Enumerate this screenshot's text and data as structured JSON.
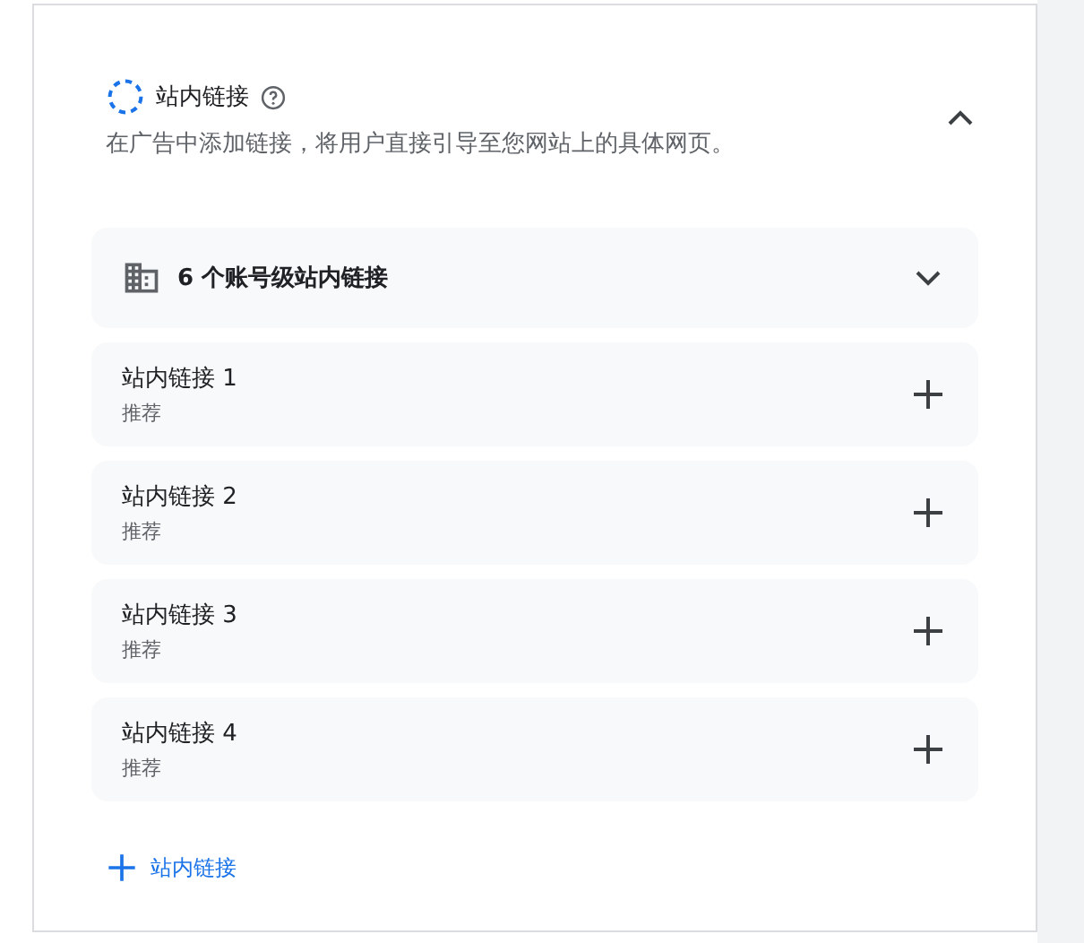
{
  "section": {
    "title": "站内链接",
    "description": "在广告中添加链接，将用户直接引导至您网站上的具体网页。",
    "expanded": true
  },
  "account_links": {
    "label": "6 个账号级站内链接",
    "expanded": false
  },
  "links": [
    {
      "title": "站内链接 1",
      "subtitle": "推荐"
    },
    {
      "title": "站内链接 2",
      "subtitle": "推荐"
    },
    {
      "title": "站内链接 3",
      "subtitle": "推荐"
    },
    {
      "title": "站内链接 4",
      "subtitle": "推荐"
    }
  ],
  "add_button": {
    "label": "站内链接"
  }
}
